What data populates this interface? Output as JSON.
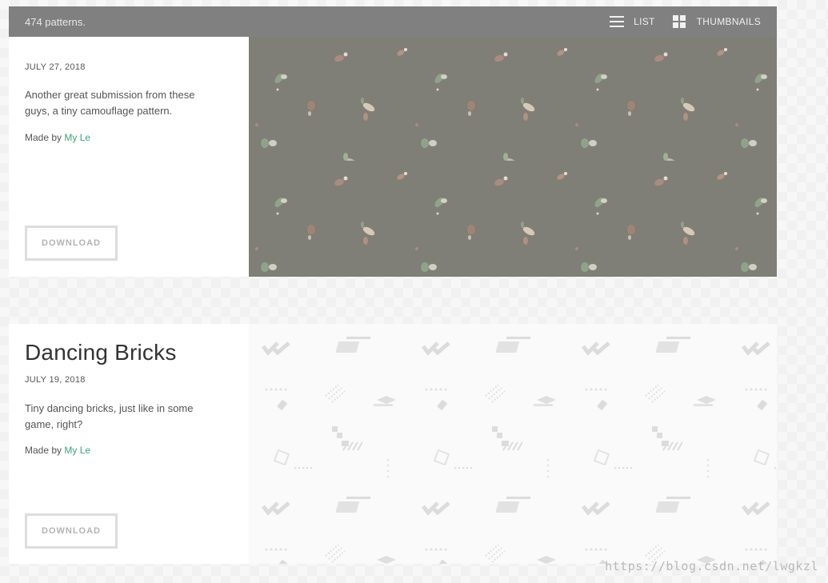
{
  "header": {
    "count": "474 patterns.",
    "list_label": "LIST",
    "thumbnails_label": "THUMBNAILS"
  },
  "patterns": [
    {
      "title": "",
      "date": "JULY 27, 2018",
      "description": "Another great submission from these guys, a tiny camouflage pattern.",
      "made_by_prefix": "Made by",
      "author": "My Le",
      "download_label": "DOWNLOAD"
    },
    {
      "title": "Dancing Bricks",
      "date": "JULY 19, 2018",
      "description": "Tiny dancing bricks, just like in some game, right?",
      "made_by_prefix": "Made by",
      "author": "My Le",
      "download_label": "DOWNLOAD"
    }
  ],
  "watermark": "https://blog.csdn.net/lwgkzl",
  "colors": {
    "accent": "#3aa57a",
    "topbar": "#808080",
    "camo_bg": "#7f7e77"
  }
}
